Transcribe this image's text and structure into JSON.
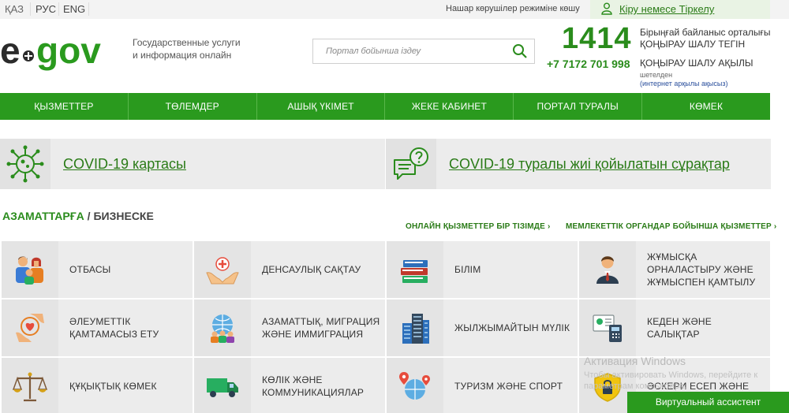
{
  "topbar": {
    "langs": [
      "ҚАЗ",
      "РУС",
      "ENG"
    ],
    "impaired_label": "Нашар көрушілер режиміне көшу",
    "login_label": "Кіру немесе Тіркелу"
  },
  "header": {
    "logo_text": "egov",
    "subtitle_line1": "Государственные услуги",
    "subtitle_line2": "и информация онлайн",
    "search_placeholder": "Портал бойынша іздеу",
    "phone_short": "1414",
    "phone_short_note1": "Бірыңғай байланыс орталығы",
    "phone_short_note2": "ҚОҢЫРАУ ШАЛУ ТЕГІН",
    "phone_long": "+7 7172 701 998",
    "phone_long_note": "ҚОҢЫРАУ ШАЛУ АҚЫЛЫ",
    "abroad": "шетелден",
    "abroad_note": "(интернет арқылы ақысыз)"
  },
  "nav": {
    "items": [
      "ҚЫЗМЕТТЕР",
      "ТӨЛЕМДЕР",
      "АШЫҚ ҮКІМЕТ",
      "ЖЕКЕ КАБИНЕТ",
      "ПОРТАЛ ТУРАЛЫ",
      "КӨМЕК"
    ]
  },
  "covid": {
    "map_label": "COVID-19 картасы",
    "faq_label": "COVID-19 туралы жиі қойылатын сұрақтар"
  },
  "section": {
    "citizens": "АЗАМАТТАРҒА",
    "slash": " / ",
    "business": "БИЗНЕСКЕ",
    "link_list": "ОНЛАЙН ҚЫЗМЕТТЕР БІР ТІЗІМДЕ ›",
    "link_gov": "МЕМЛЕКЕТТІК ОРГАНДАР БОЙЫНША ҚЫЗМЕТТЕР ›"
  },
  "tiles": [
    {
      "label": "ОТБАСЫ",
      "icon": "family-icon"
    },
    {
      "label": "ДЕНСАУЛЫҚ САҚТАУ",
      "icon": "healthcare-icon"
    },
    {
      "label": "БІЛІМ",
      "icon": "books-icon"
    },
    {
      "label": "ЖҰМЫСҚА ОРНАЛАСТЫРУ ЖӘНЕ ЖҰМЫСПЕН ҚАМТЫЛУ",
      "icon": "employee-icon"
    },
    {
      "label": "ӘЛЕУМЕТТІК ҚАМТАМАСЫЗ ЕТУ",
      "icon": "social-care-icon"
    },
    {
      "label": "АЗАМАТТЫҚ, МИГРАЦИЯ ЖӘНЕ ИММИГРАЦИЯ",
      "icon": "globe-people-icon"
    },
    {
      "label": "ЖЫЛЖЫМАЙТЫН МҮЛІК",
      "icon": "buildings-icon"
    },
    {
      "label": "КЕДЕН ЖӘНЕ САЛЫҚТАР",
      "icon": "customs-icon"
    },
    {
      "label": "ҚҰҚЫҚТЫҚ КӨМЕК",
      "icon": "scales-icon"
    },
    {
      "label": "КӨЛІК ЖӘНЕ КОММУНИКАЦИЯЛАР",
      "icon": "truck-icon"
    },
    {
      "label": "ТУРИЗМ ЖӘНЕ СПОРТ",
      "icon": "travel-icon"
    },
    {
      "label": "ӘСКЕРИ ЕСЕП ЖӘНЕ",
      "icon": "shield-lock-icon"
    }
  ],
  "overlay": {
    "watermark_title": "Активация Windows",
    "watermark_text": "Чтобы активировать Windows, перейдите к параметрам компьютера.",
    "assistant_label": "Виртуальный ассистент"
  },
  "colors": {
    "brand_green": "#2a9a1e",
    "link_green": "#2a7b17",
    "tile_bg": "#ececec"
  }
}
